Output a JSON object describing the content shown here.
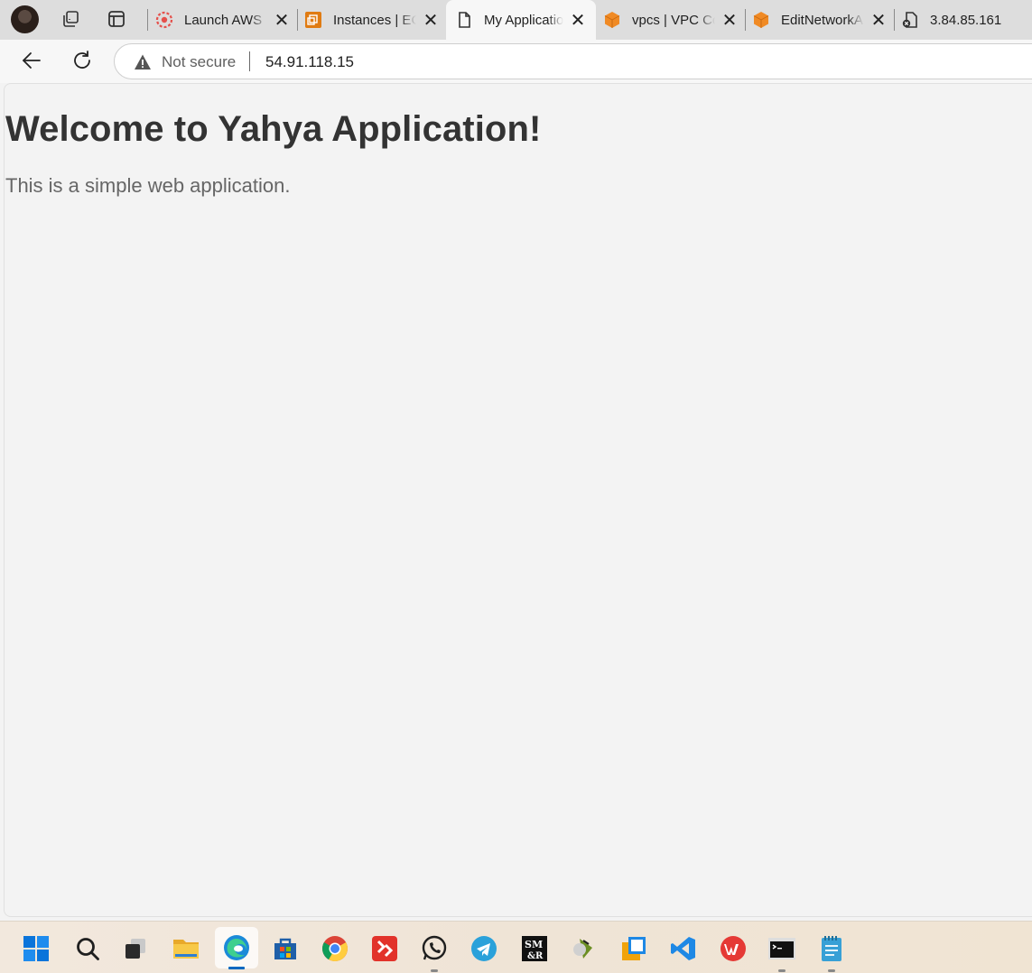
{
  "browser": {
    "tabs": [
      {
        "title": "Launch AWS",
        "icon": "aws-training-icon",
        "color": "#e5504b"
      },
      {
        "title": "Instances | EC",
        "icon": "ec2-icon",
        "color": "#e07b12"
      },
      {
        "title": "My Applicatio",
        "icon": "page-icon",
        "color": "#333333",
        "active": true
      },
      {
        "title": "vpcs | VPC Co",
        "icon": "vpc-cube-icon",
        "color": "#f08a24"
      },
      {
        "title": "EditNetworkA",
        "icon": "vpc-cube-icon",
        "color": "#f08a24"
      },
      {
        "title": "3.84.85.161",
        "icon": "broken-page-icon",
        "color": "#333333"
      }
    ],
    "close_glyph": "✕",
    "address_bar": {
      "security_label": "Not secure",
      "url": "54.91.118.15"
    }
  },
  "page": {
    "heading": "Welcome to Yahya Application!",
    "paragraph": "This is a simple web application."
  },
  "taskbar": {
    "items": [
      {
        "name": "start-icon",
        "color": "#0a74da"
      },
      {
        "name": "search-icon",
        "color": "#1f1f1f"
      },
      {
        "name": "task-view-icon",
        "color": "#1f1f1f"
      },
      {
        "name": "file-explorer-icon",
        "color": "#f5c23b"
      },
      {
        "name": "edge-icon",
        "color": "#1b8ad8",
        "active": true
      },
      {
        "name": "microsoft-store-icon",
        "color": "#1f5fa8"
      },
      {
        "name": "chrome-icon",
        "color": "#db4437"
      },
      {
        "name": "app-red-icon",
        "color": "#e2322a"
      },
      {
        "name": "whatsapp-icon",
        "color": "#25d366",
        "running": true
      },
      {
        "name": "telegram-icon",
        "color": "#2aa1da"
      },
      {
        "name": "smr-icon",
        "color": "#111111"
      },
      {
        "name": "mobaxterm-icon",
        "color": "#6b8e23"
      },
      {
        "name": "virtualbox-icon",
        "color": "#f0a30a"
      },
      {
        "name": "vscode-icon",
        "color": "#1e88e5"
      },
      {
        "name": "wps-office-icon",
        "color": "#e53935"
      },
      {
        "name": "terminal-icon",
        "color": "#222222",
        "running": true
      },
      {
        "name": "notepad-icon",
        "color": "#37a0d6",
        "running": true
      }
    ]
  }
}
